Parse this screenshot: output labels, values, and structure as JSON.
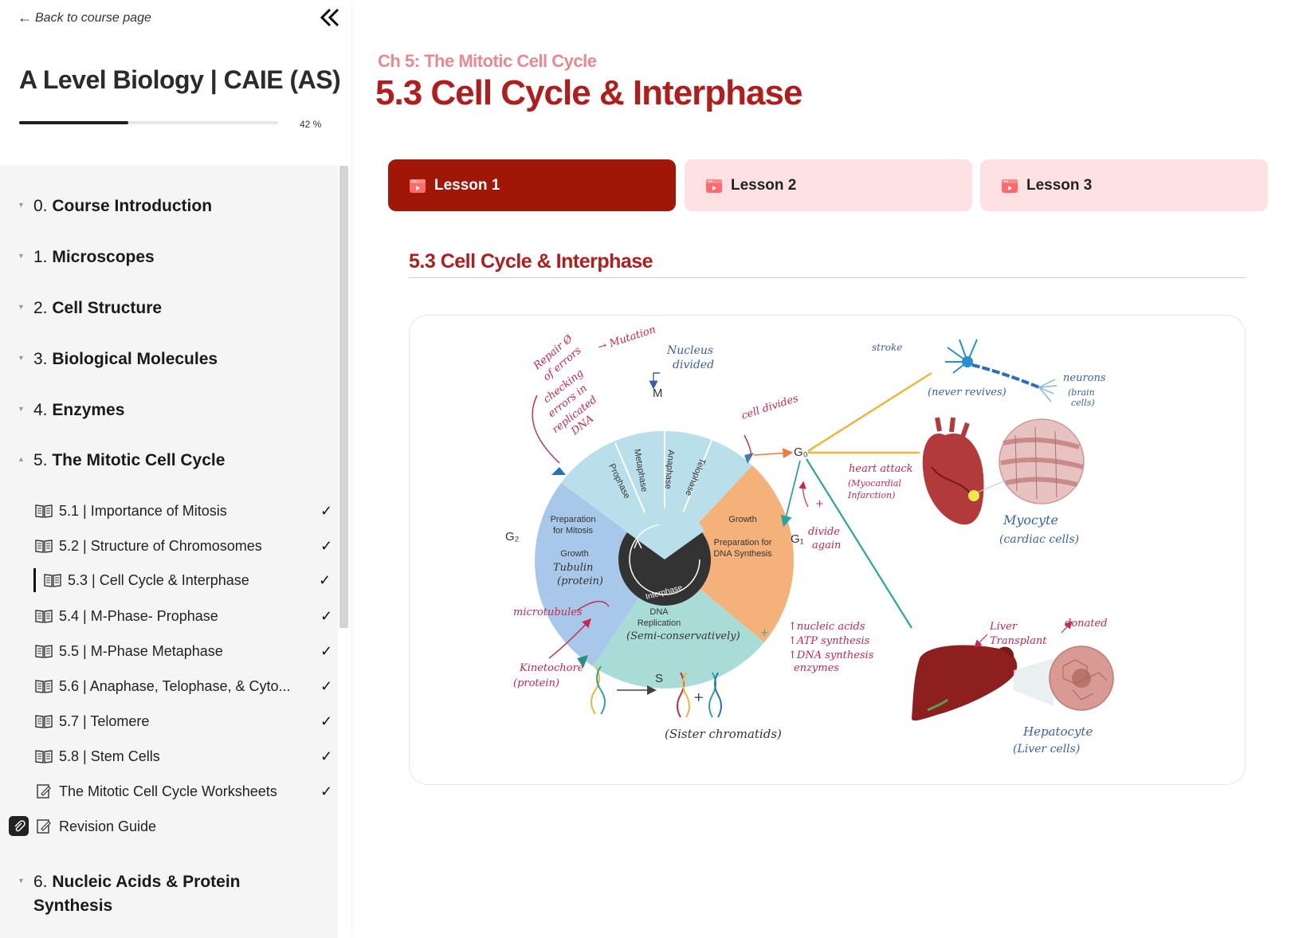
{
  "sidebar": {
    "back_link": "Back to course page",
    "course_title": "A Level Biology | CAIE (AS)",
    "progress": {
      "percent": 42,
      "label": "42 %"
    },
    "chapters_top": [
      {
        "num": "0.",
        "name": "Course Introduction"
      },
      {
        "num": "1.",
        "name": "Microscopes"
      },
      {
        "num": "2.",
        "name": "Cell Structure"
      },
      {
        "num": "3.",
        "name": "Biological Molecules"
      },
      {
        "num": "4.",
        "name": "Enzymes"
      },
      {
        "num": "5.",
        "name": "The Mitotic Cell Cycle"
      }
    ],
    "lessons": [
      {
        "label": "5.1 | Importance of Mitosis",
        "check": "✓"
      },
      {
        "label": "5.2 | Structure of Chromosomes",
        "check": "✓"
      },
      {
        "label": "5.3 | Cell Cycle & Interphase",
        "check": "✓"
      },
      {
        "label": "5.4 | M-Phase- Prophase",
        "check": "✓"
      },
      {
        "label": "5.5 | M-Phase Metaphase",
        "check": "✓"
      },
      {
        "label": "5.6 | Anaphase, Telophase, & Cyto...",
        "check": "✓"
      },
      {
        "label": "5.7 | Telomere",
        "check": "✓"
      },
      {
        "label": "5.8 | Stem Cells",
        "check": "✓"
      },
      {
        "label": "The Mitotic Cell Cycle Worksheets",
        "check": "✓"
      },
      {
        "label": "Revision Guide",
        "check": ""
      }
    ],
    "chapter_6": {
      "num": "6.",
      "name_line1": "Nucleic Acids & Protein",
      "name_line2": "Synthesis"
    }
  },
  "main": {
    "chapter_label": "Ch 5: The Mitotic Cell Cycle",
    "title": "5.3  Cell Cycle & Interphase",
    "tabs": [
      {
        "label": "Lesson 1",
        "active": true
      },
      {
        "label": "Lesson 2",
        "active": false
      },
      {
        "label": "Lesson 3",
        "active": false
      }
    ],
    "section_heading": "5.3 Cell Cycle & Interphase"
  },
  "diagram": {
    "phase_labels": {
      "M": "M",
      "G2": "G₂",
      "S": "S",
      "G0": "G₀",
      "G1": "G₁",
      "prophase": "Prophase",
      "metaphase": "Metaphase",
      "anaphase": "Anaphase",
      "telophase": "Telophase",
      "interphase": "Interphase",
      "g2_prep": "Preparation",
      "g2_prep2": "for Mitosis",
      "g2_growth": "Growth",
      "g1_growth": "Growth",
      "g1_prep": "Preparation for",
      "g1_prep2": "DNA Synthesis",
      "s_dna": "DNA",
      "s_rep": "Replication"
    },
    "annotations": {
      "repair": "Repair Ø",
      "errors": "of errors",
      "mutation": "→ Mutation",
      "checking": "checking",
      "errors_in": "errors in",
      "replicated": "replicated",
      "dna": "DNA",
      "nucleus1": "Nucleus",
      "nucleus2": "divided",
      "cell_divides": "cell divides",
      "stroke": "stroke",
      "never_revives": "(never revives)",
      "neurons": "neurons",
      "brain_cells1": "(brain",
      "brain_cells2": "cells)",
      "heart_attack": "heart attack",
      "myocardial1": "(Myocardial",
      "myocardial2": "Infarction)",
      "divide_again1": "divide",
      "divide_again2": "again",
      "myocyte": "Myocyte",
      "cardiac_cells": "(cardiac cells)",
      "tubulin1": "Tubulin",
      "tubulin2": "(protein)",
      "microtubules": "microtubules",
      "semi": "(Semi-conservatively)",
      "nucleic_acids": "↑nucleic acids",
      "atp": "↑ATP synthesis",
      "dna_enz1": "↑DNA synthesis",
      "dna_enz2": "enzymes",
      "liver1": "Liver",
      "liver2": "Transplant",
      "donated": "donated",
      "kinetochore1": "Kinetochore",
      "kinetochore2": "(protein)",
      "sister": "(Sister chromatids)",
      "hepatocyte1": "Hepatocyte",
      "hepatocyte2": "(Liver cells)",
      "plus_g1": "+",
      "plus_s": "+",
      "plus_chrom": "+"
    },
    "colors": {
      "g2": "#a8c8ea",
      "m": "#b9e0ea",
      "g1": "#f4b27a",
      "s": "#a9dcd6",
      "hub": "#333333",
      "annotation_red": "#c8274f",
      "annotation_blue": "#3a5fa8",
      "line_yellow": "#f0b43a",
      "line_teal": "#2aa59a"
    }
  }
}
